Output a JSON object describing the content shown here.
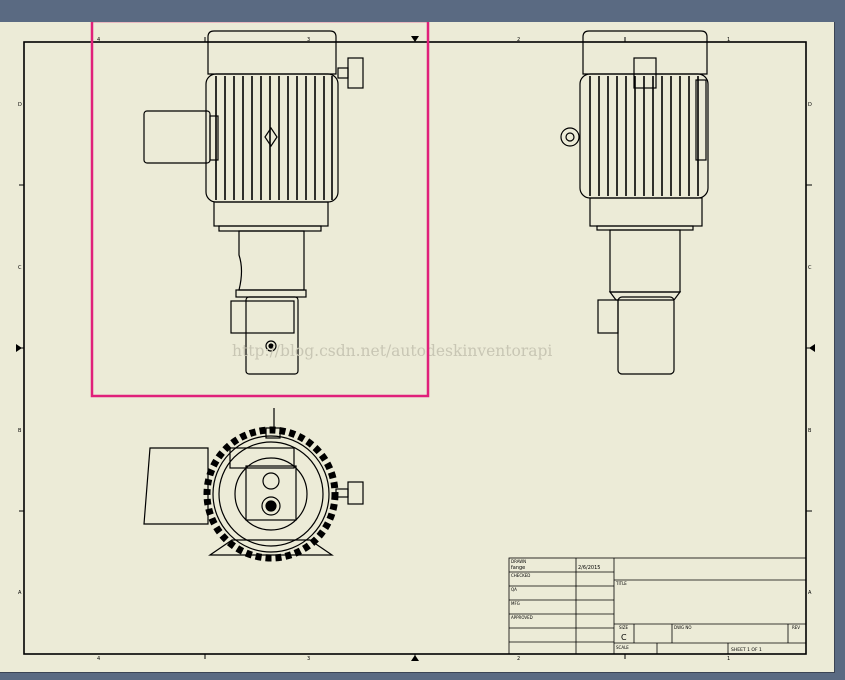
{
  "zone_numbers": [
    "4",
    "3",
    "2",
    "1"
  ],
  "zone_letters": [
    "D",
    "C",
    "B",
    "A"
  ],
  "watermark": "http://blog.csdn.net/autodeskinventorapi",
  "title_block": {
    "drawn_label": "DRAWN",
    "drawn_by": "fange",
    "drawn_date": "2/6/2015",
    "checked_label": "CHECKED",
    "qa_label": "QA",
    "mfg_label": "MFG",
    "approved_label": "APPROVED",
    "title_label": "TITLE",
    "size_label": "SIZE",
    "size_value": "C",
    "dwg_no_label": "DWG NO",
    "rev_label": "REV",
    "scale_label": "SCALE",
    "sheet_text": "SHEET 1  OF 1"
  },
  "selection": {
    "color": "#e0207a"
  },
  "colors": {
    "sheet": "#ecebd7",
    "background": "#5a6a82",
    "line": "#000000"
  }
}
